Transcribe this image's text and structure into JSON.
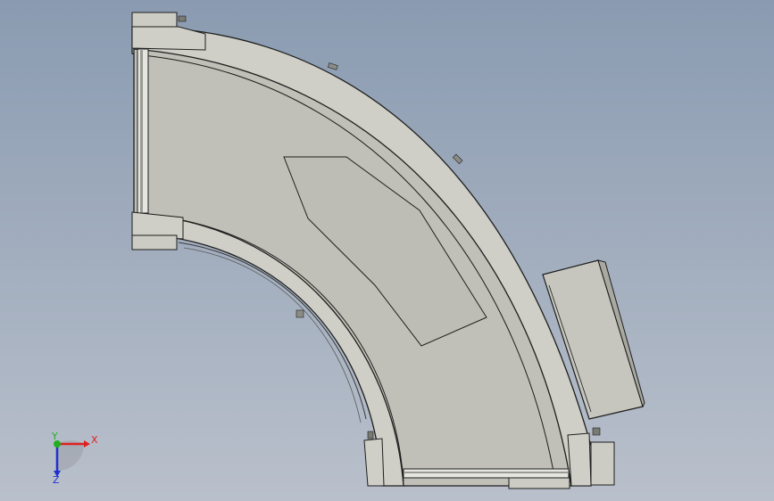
{
  "viewport": {
    "background_top": "#8a9bb1",
    "background_bottom": "#b9c0cb"
  },
  "model": {
    "body_fill": "#c0c0b8",
    "edge_color": "#1e1e1e",
    "frame_fill": "#ccccc4",
    "roller_fill": "#e6e6e0"
  },
  "triad": {
    "x_label": "X",
    "y_label": "Y",
    "z_label": "Z",
    "x_color": "#e02020",
    "y_color": "#20b020",
    "z_color": "#2030d0"
  }
}
